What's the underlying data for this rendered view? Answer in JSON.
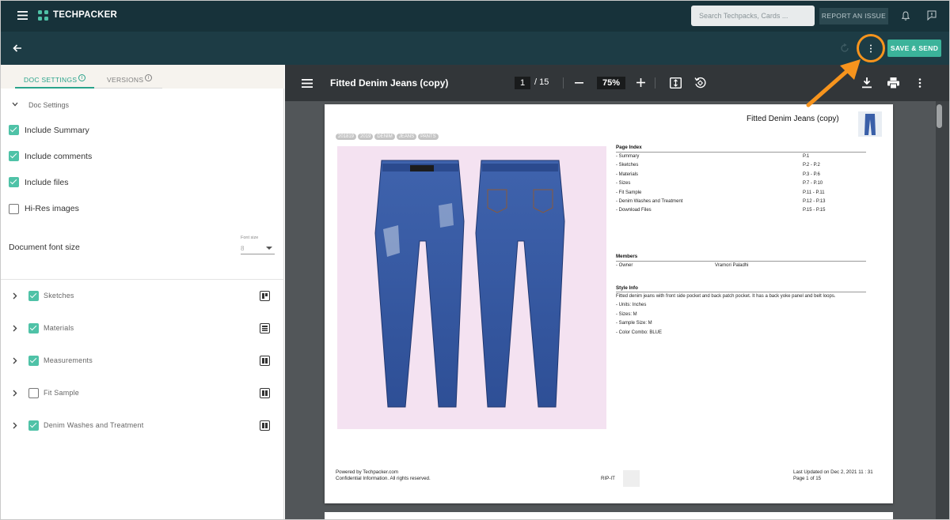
{
  "topbar": {
    "brand": "TECHPACKER",
    "search_placeholder": "Search Techpacks, Cards ...",
    "report_label": "REPORT AN ISSUE"
  },
  "subbar": {
    "save_label": "SAVE & SEND"
  },
  "left_panel": {
    "tabs": [
      {
        "label": "DOC SETTINGS",
        "active": true
      },
      {
        "label": "VERSIONS",
        "active": false
      }
    ],
    "section_title": "Doc Settings",
    "options": [
      {
        "label": "Include Summary",
        "checked": true
      },
      {
        "label": "Include comments",
        "checked": true
      },
      {
        "label": "Include files",
        "checked": true
      },
      {
        "label": "Hi-Res images",
        "checked": false
      }
    ],
    "font_size_label": "Document font size",
    "font_size_caption": "Font size",
    "font_size_value": "8",
    "sections": [
      {
        "label": "Sketches",
        "checked": true,
        "icon": "layout-sketch-icon"
      },
      {
        "label": "Materials",
        "checked": true,
        "icon": "layout-grid-icon"
      },
      {
        "label": "Measurements",
        "checked": true,
        "icon": "layout-columns-icon"
      },
      {
        "label": "Fit Sample",
        "checked": false,
        "icon": "layout-columns-icon"
      },
      {
        "label": "Denim Washes and Treatment",
        "checked": true,
        "icon": "layout-columns-icon"
      }
    ]
  },
  "viewer": {
    "title": "Fitted Denim Jeans (copy)",
    "page_current": "1",
    "page_total": "/ 15",
    "zoom": "75%"
  },
  "document": {
    "title": "Fitted Denim Jeans (copy)",
    "tags": [
      "201819",
      "2019",
      "DENIM",
      "JEANS",
      "PANTS"
    ],
    "page_index_heading": "Page Index",
    "page_index": [
      {
        "name": "- Summary",
        "pages": "P.1"
      },
      {
        "name": "- Sketches",
        "pages": "P.2 - P.2"
      },
      {
        "name": "- Materials",
        "pages": "P.3 - P.6"
      },
      {
        "name": "- Sizes",
        "pages": "P.7 - P.10"
      },
      {
        "name": "- Fit Sample",
        "pages": "P.11 - P.11"
      },
      {
        "name": "- Denim Washes and Treatment",
        "pages": "P.12 - P.13"
      },
      {
        "name": "- Download Files",
        "pages": "P.15 - P.15"
      }
    ],
    "members_heading": "Members",
    "member_role": "- Owner",
    "member_name": "Vramori Paladhi",
    "style_heading": "Style Info",
    "style_lines": [
      "Fitted denim jeans with front side pocket and back patch pocket. It has a back yoke panel and belt loops.",
      "- Units: Inches",
      "- Sizes: M",
      "- Sample Size: M",
      "- Color Combo: BLUE"
    ],
    "footer_left_1": "Powered by Techpacker.com",
    "footer_left_2": "Confidential Information. All rights reserved.",
    "footer_center": "RIP-IT",
    "footer_right_1": "Last Updated on Dec 2, 2021 11 : 31",
    "footer_right_2": "Page 1 of 15"
  },
  "colors": {
    "topbar": "#17323a",
    "subbar": "#1d3c45",
    "accent": "#3bb39a",
    "highlight": "#f7941d",
    "denim": "#3a5fa8"
  }
}
